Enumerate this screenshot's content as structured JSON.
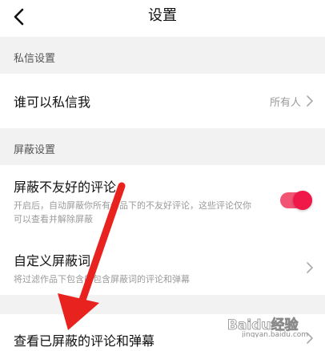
{
  "header": {
    "title": "设置",
    "back_icon": "back-chevron-icon"
  },
  "sections": [
    {
      "label": "私信设置",
      "rows": [
        {
          "title": "谁可以私信我",
          "value": "所有人"
        }
      ]
    },
    {
      "label": "屏蔽设置",
      "rows": [
        {
          "title": "屏蔽不友好的评论",
          "subtitle": "开启后，自动屏蔽你所有作品下的不友好评论，这些评论仅你可以查看并解除屏蔽",
          "toggle_on": true
        },
        {
          "title": "自定义屏蔽词",
          "subtitle": "将过滤作品下包含的包含屏蔽词的评论和弹幕"
        }
      ]
    },
    {
      "label": "",
      "rows": [
        {
          "title": "查看已屏蔽的评论和弹幕"
        }
      ]
    }
  ],
  "overlay": {
    "arrow_color": "#e8231f"
  },
  "watermark": {
    "text": "Baidu经验",
    "subtext": "jingyan.baidu.com"
  },
  "colors": {
    "accent": "#f01848",
    "toggle_track": "#f25474",
    "background": "#f2f2f2"
  }
}
